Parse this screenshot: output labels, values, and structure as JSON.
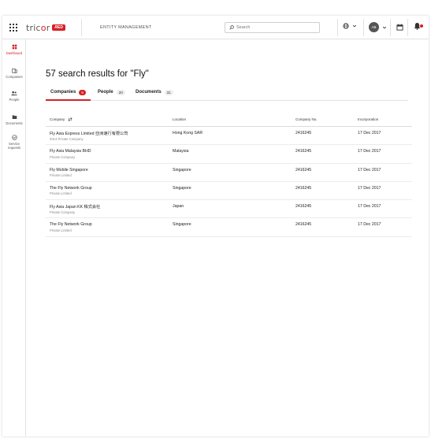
{
  "topbar": {
    "logo_text": "tricor",
    "logo_badge": "RED",
    "app_title": "ENTITY MANAGEMENT",
    "search_placeholder": "Search",
    "avatar_initials": "AB"
  },
  "sidebar": {
    "items": [
      {
        "label": "Dashboard",
        "icon": "dashboard-icon",
        "active": true
      },
      {
        "label": "Companies",
        "icon": "building-icon",
        "active": false
      },
      {
        "label": "People",
        "icon": "people-icon",
        "active": false
      },
      {
        "label": "Documents",
        "icon": "folder-icon",
        "active": false
      },
      {
        "label": "Service requests",
        "icon": "check-circle-icon",
        "active": false
      }
    ]
  },
  "main": {
    "heading": "57 search results for \"Fly\"",
    "tabs": [
      {
        "label": "Companies",
        "count": "6",
        "active": true
      },
      {
        "label": "People",
        "count": "20",
        "active": false
      },
      {
        "label": "Documents",
        "count": "31",
        "active": false
      }
    ],
    "table": {
      "columns": [
        "Company",
        "Location",
        "Company No.",
        "Incorporation"
      ],
      "rows": [
        {
          "name": "Fly Asia Express Limited 亞洲速行有限公司",
          "type": "2014 Private Company",
          "location": "Hong Kong SAR",
          "company_no": "2416245",
          "incorporation": "17 Dec 2017"
        },
        {
          "name": "Fly Asia Malaysia BHD",
          "type": "Private Company",
          "location": "Malaysia",
          "company_no": "2416245",
          "incorporation": "17 Dec 2017"
        },
        {
          "name": "Fly Mobile Singapore",
          "type": "Private Limited",
          "location": "Singapore",
          "company_no": "2416245",
          "incorporation": "17 Dec 2017"
        },
        {
          "name": "The Fly Network Group",
          "type": "Private Limited",
          "location": "Singapore",
          "company_no": "2416245",
          "incorporation": "17 Dec 2017"
        },
        {
          "name": "Fly Asia Japan KK 株式会社",
          "type": "Private Company",
          "location": "Japan",
          "company_no": "2416245",
          "incorporation": "17 Dec 2017"
        },
        {
          "name": "The Fly Network Group",
          "type": "Private Limited",
          "location": "Singapore",
          "company_no": "2416245",
          "incorporation": "17 Dec 2017"
        }
      ]
    }
  },
  "colors": {
    "accent": "#d81f26",
    "text": "#222222",
    "muted": "#888888",
    "border": "#e2e2e2"
  }
}
